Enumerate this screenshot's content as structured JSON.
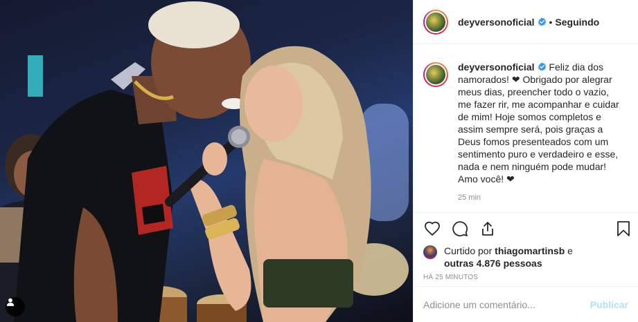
{
  "post": {
    "username": "deyversonoficial",
    "follow_status": "Seguindo",
    "separator": "•",
    "caption_username": "deyversonoficial",
    "caption_text": " Feliz dia dos namorados! ❤ Obrigado por alegrar meus dias, preencher todo o vazio, me fazer rir, me acompanhar e cuidar de mim! Hoje somos completos e assim sempre será, pois graças a Deus fomos presenteados com um sentimento puro e verdadeiro e esse, nada e nem ninguém pode mudar! Amo você! ❤",
    "caption_time": "25 min",
    "liked_by_prefix": "Curtido por ",
    "liked_by_user": "thiagomartinsb",
    "liked_by_mid": " e ",
    "liked_by_others": "outras 4.876 pessoas",
    "date": "HÁ 25 MINUTOS"
  },
  "comment": {
    "placeholder": "Adicione um comentário...",
    "publish_label": "Publicar"
  },
  "icons": {
    "like": "heart-icon",
    "comment": "comment-icon",
    "share": "share-icon",
    "save": "bookmark-icon",
    "verified": "verified-badge-icon",
    "tag": "user-tag-icon"
  },
  "colors": {
    "verified_blue": "#3897f0",
    "publish_disabled": "#b2dffc",
    "muted_text": "#8e8e8e",
    "border": "#efefef"
  }
}
